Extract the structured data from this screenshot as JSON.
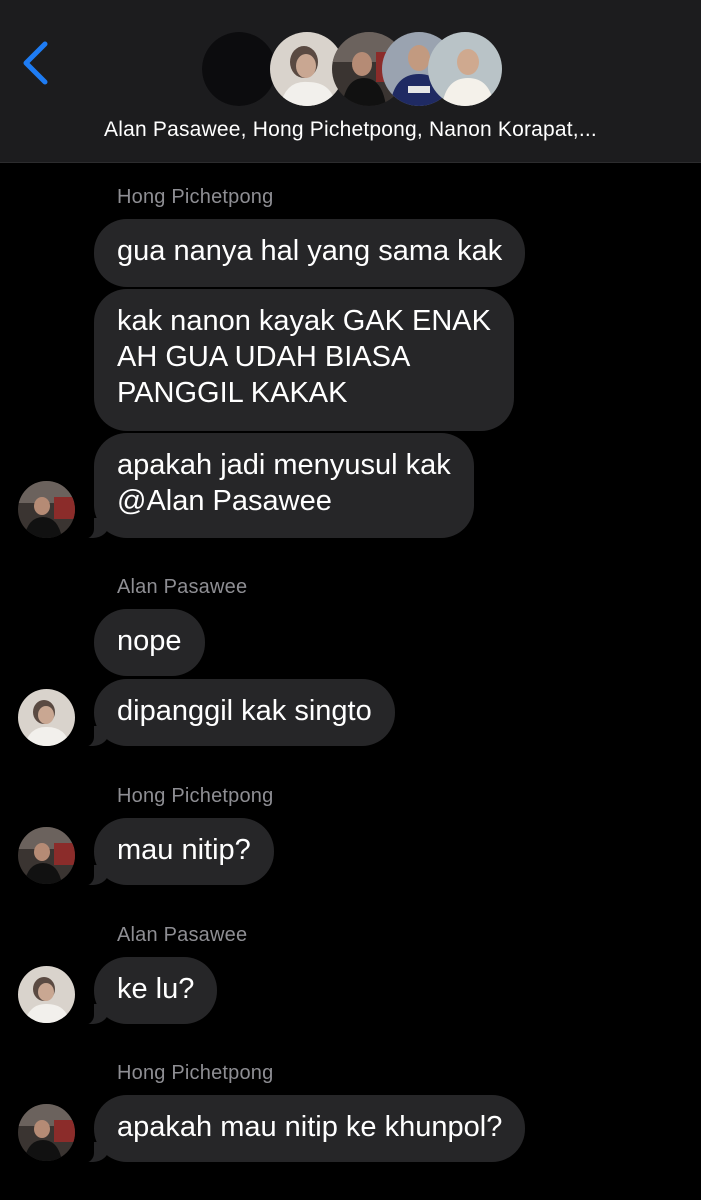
{
  "header": {
    "title": "Alan Pasawee, Hong Pichetpong, Nanon Korapat,...",
    "back_icon": "chevron-left-icon",
    "accent_color": "#1e7cf4",
    "participants": [
      "blank-avatar",
      "alan-pasawee-avatar",
      "hong-pichetpong-avatar",
      "nanon-korapat-avatar",
      "member-avatar"
    ]
  },
  "messages": [
    {
      "sender": "Hong Pichetpong",
      "text": "gua nanya hal yang sama kak"
    },
    {
      "text": "kak nanon kayak GAK ENAK\nAH GUA UDAH BIASA\nPANGGIL KAKAK"
    },
    {
      "text": "apakah jadi menyusul kak\n@Alan Pasawee"
    },
    {
      "sender": "Alan Pasawee",
      "text": "nope"
    },
    {
      "text": "dipanggil kak singto"
    },
    {
      "sender": "Hong Pichetpong",
      "text": "mau nitip?"
    },
    {
      "sender": "Alan Pasawee",
      "text": "ke lu?"
    },
    {
      "sender": "Hong Pichetpong",
      "text": "apakah mau nitip ke khunpol?"
    }
  ],
  "colors": {
    "background": "#000000",
    "header_bg": "#1c1c1e",
    "bubble": "#262628",
    "sender_text": "#8e8e93"
  }
}
